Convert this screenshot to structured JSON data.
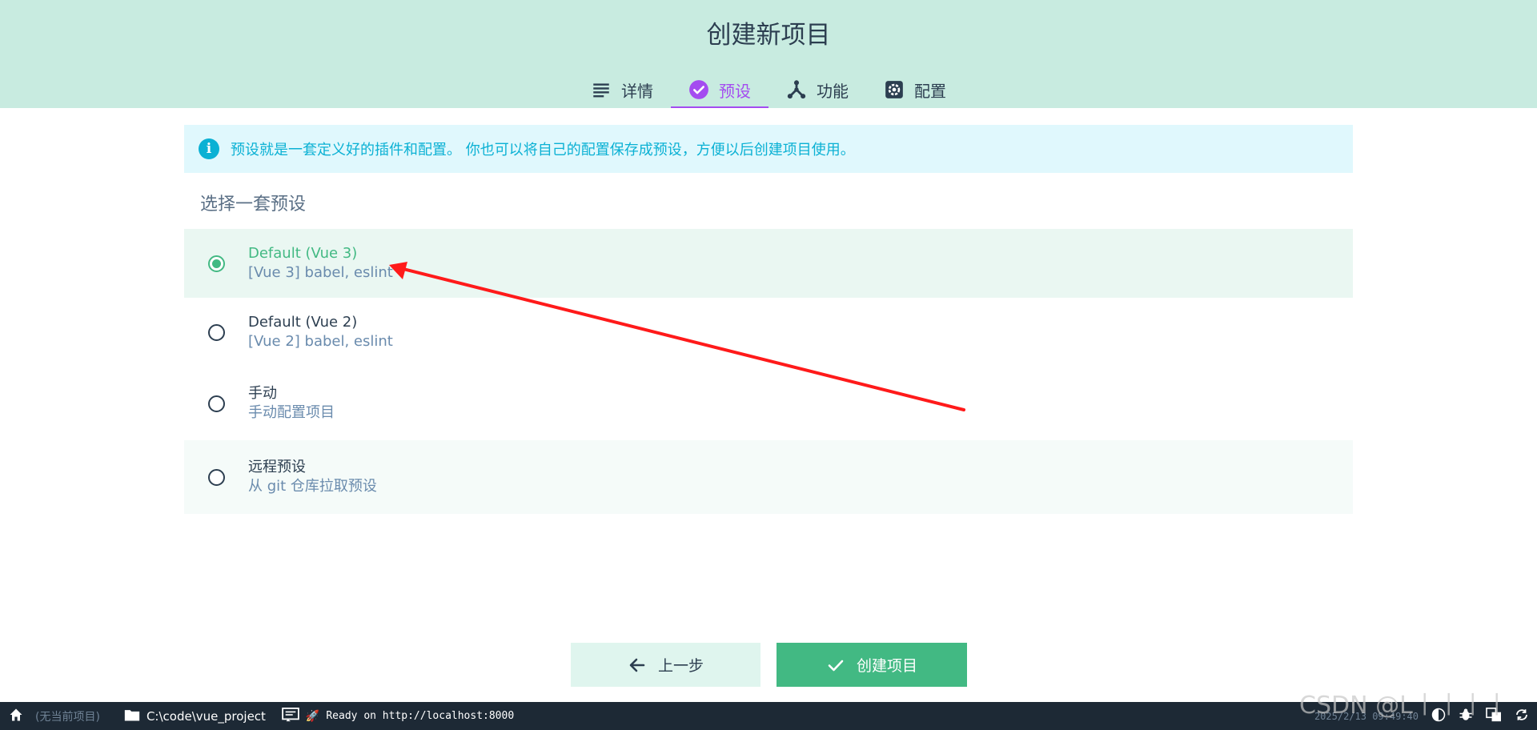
{
  "header": {
    "title": "创建新项目",
    "tabs": [
      {
        "label": "详情",
        "icon": "list-icon"
      },
      {
        "label": "预设",
        "icon": "check-circle-icon",
        "active": true
      },
      {
        "label": "功能",
        "icon": "fork-icon"
      },
      {
        "label": "配置",
        "icon": "gear-icon"
      }
    ]
  },
  "info": {
    "text": "预设就是一套定义好的插件和配置。 你也可以将自己的配置保存成预设，方便以后创建项目使用。"
  },
  "section_title": "选择一套预设",
  "presets": [
    {
      "name": "Default (Vue 3)",
      "desc": "[Vue 3] babel, eslint",
      "selected": true
    },
    {
      "name": "Default (Vue 2)",
      "desc": "[Vue 2] babel, eslint",
      "selected": false
    },
    {
      "name": "手动",
      "desc": "手动配置项目",
      "selected": false
    },
    {
      "name": "远程预设",
      "desc": "从 git 仓库拉取预设",
      "selected": false
    }
  ],
  "buttons": {
    "prev": "上一步",
    "create": "创建项目"
  },
  "statusbar": {
    "no_project": "(无当前项目)",
    "path": "C:\\code\\vue_project",
    "log": "Ready on http://localhost:8000",
    "time": "2025/2/13 09:49:40"
  },
  "watermark": "CSDN @L丨丨丨丨",
  "colors": {
    "header_bg": "#c8ebe0",
    "accent": "#42b983",
    "active_tab": "#a44cf0",
    "info": "#0bb1d4",
    "statusbar_bg": "#1d2935",
    "annotation_arrow": "#ff1a1a"
  }
}
